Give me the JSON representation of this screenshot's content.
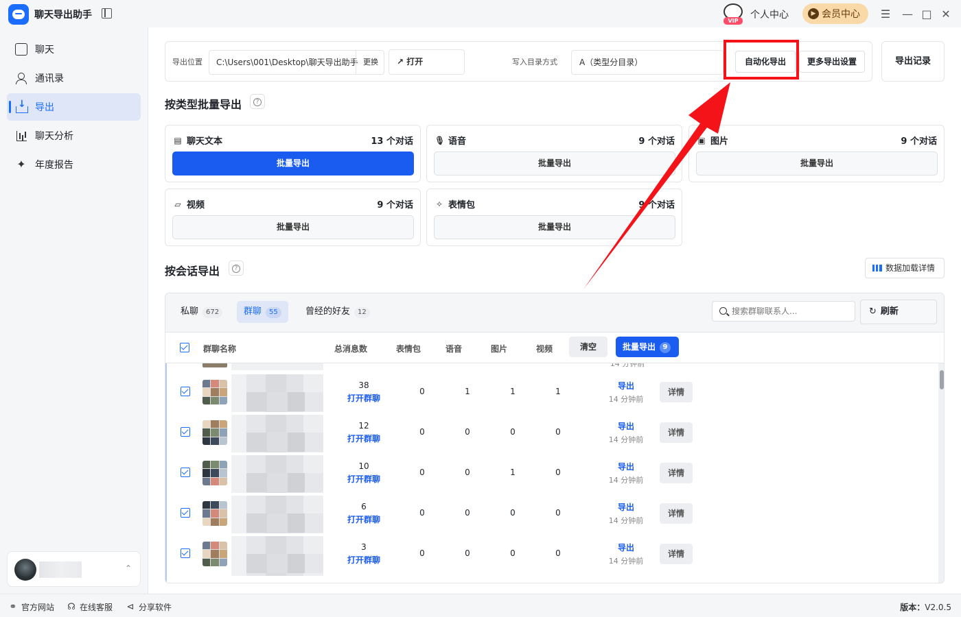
{
  "app": {
    "title": "聊天导出助手",
    "personal_center": "个人中心",
    "member_center": "会员中心",
    "vip_tag": "VIP"
  },
  "sidebar": {
    "items": [
      {
        "label": "聊天",
        "icon": "chat-bubble-icon"
      },
      {
        "label": "通讯录",
        "icon": "contacts-icon"
      },
      {
        "label": "导出",
        "icon": "export-download-icon",
        "active": true
      },
      {
        "label": "聊天分析",
        "icon": "bar-chart-icon"
      },
      {
        "label": "年度报告",
        "icon": "sparkle-icon"
      }
    ]
  },
  "status": {
    "website": "官方网站",
    "service": "在线客服",
    "share": "分享软件",
    "version_label": "版本：",
    "version": "V2.0.5"
  },
  "export_bar": {
    "location_label": "导出位置",
    "path": "C:\\Users\\001\\Desktop\\聊天导出助手",
    "change": "更换",
    "open": "打开",
    "dir_mode_label": "写入目录方式",
    "dir_mode_value": "A（类型分目录）",
    "auto_export": "自动化导出",
    "more_settings": "更多导出设置",
    "records": "导出记录"
  },
  "by_type": {
    "title": "按类型批量导出",
    "cards": [
      {
        "name": "聊天文本",
        "count": "13 个对话",
        "button": "批量导出",
        "primary": true,
        "icon": "message-text-icon"
      },
      {
        "name": "语音",
        "count": "9 个对话",
        "button": "批量导出",
        "icon": "microphone-icon"
      },
      {
        "name": "图片",
        "count": "9 个对话",
        "button": "批量导出",
        "icon": "image-icon"
      },
      {
        "name": "视频",
        "count": "9 个对话",
        "button": "批量导出",
        "icon": "video-icon"
      },
      {
        "name": "表情包",
        "count": "9 个对话",
        "button": "批量导出",
        "icon": "magic-wand-icon"
      }
    ]
  },
  "by_session": {
    "title": "按会话导出",
    "load_detail": "数据加载详情",
    "tabs": [
      {
        "label": "私聊",
        "count": "672"
      },
      {
        "label": "群聊",
        "count": "55",
        "active": true
      },
      {
        "label": "曾经的好友",
        "count": "12"
      }
    ],
    "search_placeholder": "搜索群聊联系人...",
    "refresh": "刷新",
    "columns": {
      "name": "群聊名称",
      "total": "总消息数",
      "sticker": "表情包",
      "voice": "语音",
      "image": "图片",
      "video": "视频"
    },
    "clear": "清空",
    "batch_export": "批量导出",
    "batch_count": "9",
    "row_open_label": "打开群聊",
    "row_export_label": "导出",
    "row_detail_label": "详情",
    "rows": [
      {
        "total": "38",
        "sticker": "0",
        "voice": "1",
        "image": "1",
        "video": "1",
        "ago": "14 分钟前"
      },
      {
        "total": "12",
        "sticker": "0",
        "voice": "0",
        "image": "0",
        "video": "0",
        "ago": "14 分钟前"
      },
      {
        "total": "10",
        "sticker": "0",
        "voice": "0",
        "image": "1",
        "video": "0",
        "ago": "14 分钟前"
      },
      {
        "total": "6",
        "sticker": "0",
        "voice": "0",
        "image": "0",
        "video": "0",
        "ago": "14 分钟前"
      },
      {
        "total": "3",
        "sticker": "0",
        "voice": "0",
        "image": "0",
        "video": "0",
        "ago": "14 分钟前"
      }
    ],
    "partial_row_ago": "14 分钟前"
  },
  "colors": {
    "accent": "#1a5cf0",
    "highlight": "#f5131a",
    "sidebar_active_bg": "#dfe6f7"
  }
}
